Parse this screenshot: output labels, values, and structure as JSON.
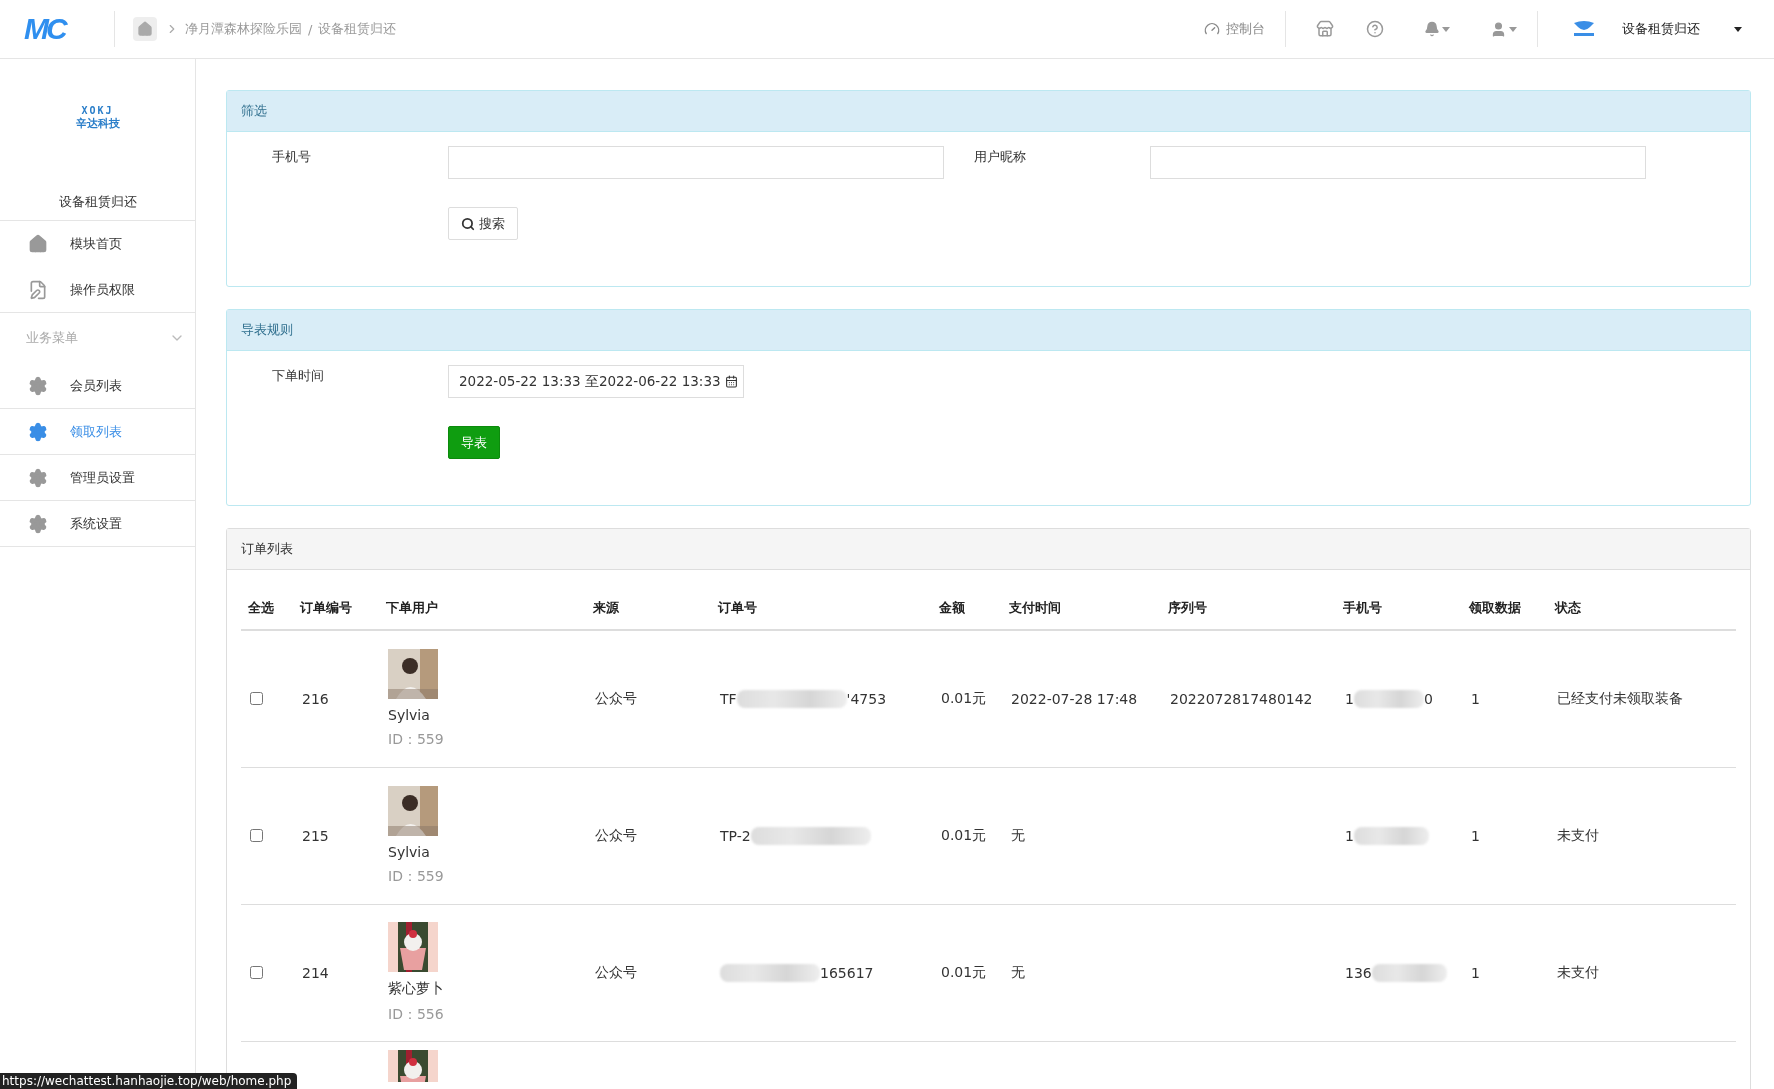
{
  "topbar": {
    "logo": "MC",
    "breadcrumb": [
      "净月潭森林探险乐园",
      "/",
      "设备租赁归还"
    ],
    "console": "控制台",
    "app_title": "设备租赁归还"
  },
  "sidebar": {
    "logo_mark": "XOKJ",
    "logo_name": "辛达科技",
    "title": "设备租赁归还",
    "top_items": [
      {
        "label": "模块首页"
      },
      {
        "label": "操作员权限"
      }
    ],
    "group": {
      "label": "业务菜单",
      "expanded": true
    },
    "items": [
      {
        "label": "会员列表",
        "selected": false
      },
      {
        "label": "领取列表",
        "selected": true
      },
      {
        "label": "管理员设置",
        "selected": false
      },
      {
        "label": "系统设置",
        "selected": false
      }
    ]
  },
  "filter": {
    "title": "筛选",
    "fields": [
      {
        "label": "手机号"
      },
      {
        "label": "用户昵称"
      }
    ],
    "button": "搜索"
  },
  "export": {
    "title": "导表规则",
    "label": "下单时间",
    "range": "2022-05-22 13:33 至2022-06-22 13:33",
    "button": "导表"
  },
  "orders": {
    "title": "订单列表",
    "columns": [
      "全选",
      "订单编号",
      "下单用户",
      "来源",
      "订单号",
      "金额",
      "支付时间",
      "序列号",
      "手机号",
      "领取数据",
      "状态"
    ],
    "rows": [
      {
        "checked": false,
        "id": "216",
        "name": "Sylvia",
        "uid": "ID：559",
        "source": "公众号",
        "order_start": "TF",
        "order_end": "'4753",
        "amount": "0.01元",
        "paid_at": "2022-07-28 17:48",
        "serial": "2022072817480142",
        "phone_start": "1",
        "phone_end": "0",
        "count": "1",
        "status": "已经支付未领取装备"
      },
      {
        "checked": false,
        "id": "215",
        "name": "Sylvia",
        "uid": "ID：559",
        "source": "公众号",
        "order_start": "TP-2",
        "amount": "0.01元",
        "paid_at": "无",
        "phone_start": "1",
        "count": "1",
        "status": "未支付"
      },
      {
        "checked": false,
        "id": "214",
        "name": "紫心萝卜",
        "uid": "ID：556",
        "source": "公众号",
        "order_end": "165617",
        "amount": "0.01元",
        "paid_at": "无",
        "phone_start": "136",
        "count": "1",
        "status": "未支付"
      }
    ]
  },
  "status_url": "https://wechattest.hanhaojie.top/web/home.php"
}
